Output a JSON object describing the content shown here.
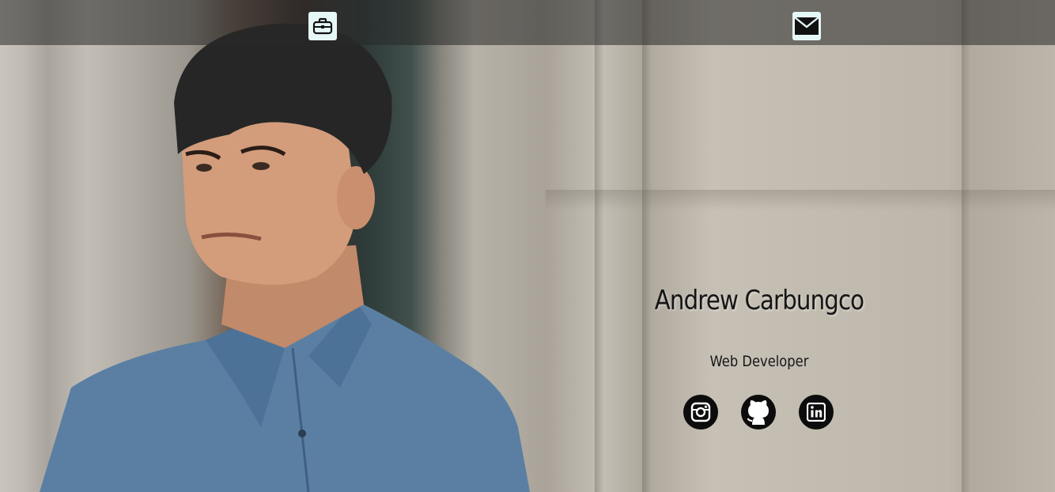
{
  "nav": {
    "items": [
      {
        "icon": "briefcase-icon",
        "label": "Portfolio"
      },
      {
        "icon": "envelope-icon",
        "label": "Contact"
      }
    ]
  },
  "hero": {
    "name": "Andrew Carbungco",
    "role": "Web Developer"
  },
  "socials": [
    {
      "icon": "instagram-icon"
    },
    {
      "icon": "github-icon"
    },
    {
      "icon": "linkedin-icon"
    }
  ],
  "colors": {
    "nav_bar": "#28282880",
    "nav_button": "#e6f7f7",
    "social_circle": "#0c0c0c",
    "text": "#151515"
  }
}
